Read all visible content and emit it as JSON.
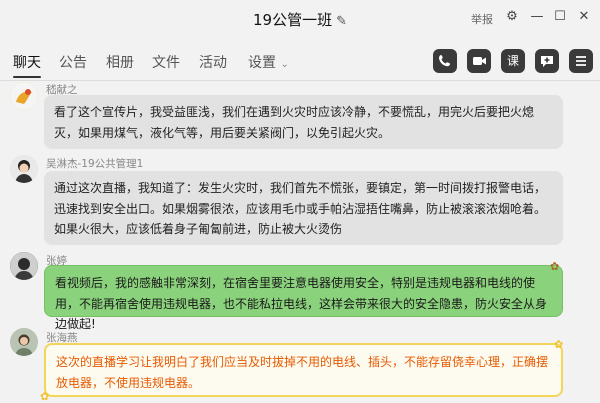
{
  "window": {
    "title": "19公管一班",
    "report_label": "举报",
    "controls": [
      "⚙",
      "—",
      "☐",
      "✕"
    ]
  },
  "tabs": [
    {
      "label": "聊天",
      "active": true
    },
    {
      "label": "公告"
    },
    {
      "label": "相册"
    },
    {
      "label": "文件"
    },
    {
      "label": "活动"
    },
    {
      "label": "设置"
    }
  ],
  "toolbar": {
    "tools": [
      "phone-icon",
      "video-icon",
      "course-icon",
      "add-comment-icon",
      "more-icon"
    ],
    "course_glyph": "课"
  },
  "messages": [
    {
      "sender": "嵇献之",
      "text": "看了这个宣传片，我受益匪浅，我们在遇到火灾时应该冷静，不要慌乱，用完火后要把火熄灭，如果用煤气，液化气等，用后要关紧阀门，以免引起火灾。",
      "style": "gray"
    },
    {
      "sender": "吴淋杰-19公共管理1",
      "text": "通过这次直播，我知道了：发生火灾时，我们首先不慌张，要镇定，第一时间拨打报警电话，迅速找到安全出口。如果烟雾很浓，应该用毛巾或手帕沾湿捂住嘴鼻，防止被滚滚浓烟呛着。如果火很大，应该低着身子匍匐前进，防止被大火烫伤",
      "style": "gray"
    },
    {
      "sender": "张婷",
      "text": "看视频后，我的感触非常深刻，在宿舍里要注意电器使用安全，特别是违规电器和电线的使用，不能再宿舍使用违规电器，也不能私拉电线，这样会带来很大的安全隐患，防火安全从身边做起!",
      "style": "green"
    },
    {
      "sender": "张海燕",
      "text": "这次的直播学习让我明白了我们应当及时拔掉不用的电线、插头，不能存留侥幸心理，正确摆放电器，不使用违规电器。",
      "style": "orange"
    }
  ],
  "colors": {
    "accent_green": "#8bd27c",
    "accent_orange_text": "#e65a00",
    "toolbar_icon_bg": "#3a3a3a"
  }
}
